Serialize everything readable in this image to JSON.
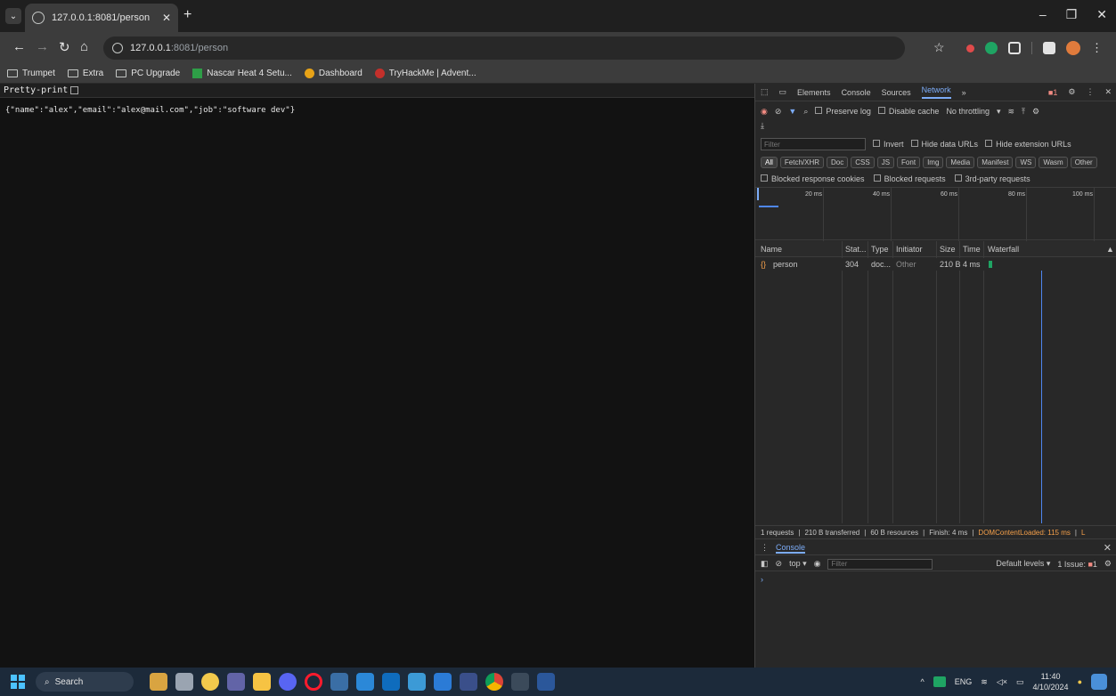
{
  "browser": {
    "tab_title": "127.0.0.1:8081/person",
    "url_host": "127.0.0.1",
    "url_path": ":8081/person",
    "bookmarks": [
      "Trumpet",
      "Extra",
      "PC Upgrade",
      "Nascar Heat 4 Setu...",
      "Dashboard",
      "TryHackMe | Advent..."
    ]
  },
  "page": {
    "pretty_print_label": "Pretty-print",
    "json_text": "{\"name\":\"alex\",\"email\":\"alex@mail.com\",\"job\":\"software dev\"}"
  },
  "devtools": {
    "tabs": [
      "Elements",
      "Console",
      "Sources",
      "Network"
    ],
    "active_tab": "Network",
    "issue_count": "1",
    "toolbar": {
      "preserve_log": "Preserve log",
      "disable_cache": "Disable cache",
      "throttling": "No throttling"
    },
    "filter_placeholder": "Filter",
    "filter_options": [
      "Invert",
      "Hide data URLs",
      "Hide extension URLs"
    ],
    "types": [
      "All",
      "Fetch/XHR",
      "Doc",
      "CSS",
      "JS",
      "Font",
      "Img",
      "Media",
      "Manifest",
      "WS",
      "Wasm",
      "Other"
    ],
    "blocked_options": [
      "Blocked response cookies",
      "Blocked requests",
      "3rd-party requests"
    ],
    "timeline_ticks": [
      "20 ms",
      "40 ms",
      "60 ms",
      "80 ms",
      "100 ms"
    ],
    "columns": [
      "Name",
      "Stat...",
      "Type",
      "Initiator",
      "Size",
      "Time",
      "Waterfall"
    ],
    "rows": [
      {
        "name": "person",
        "status": "304",
        "type": "doc...",
        "initiator": "Other",
        "size": "210 B",
        "time": "4 ms"
      }
    ],
    "status": {
      "requests": "1 requests",
      "transferred": "210 B transferred",
      "resources": "60 B resources",
      "finish": "Finish: 4 ms",
      "dcl": "DOMContentLoaded: 115 ms",
      "more": "L"
    },
    "console": {
      "title": "Console",
      "context": "top",
      "filter_placeholder": "Filter",
      "levels": "Default levels",
      "issues": "1 Issue:",
      "issue_count": "1",
      "prompt": "›"
    }
  },
  "taskbar": {
    "search_label": "Search",
    "lang": "ENG",
    "time": "11:40",
    "date": "4/10/2024"
  }
}
